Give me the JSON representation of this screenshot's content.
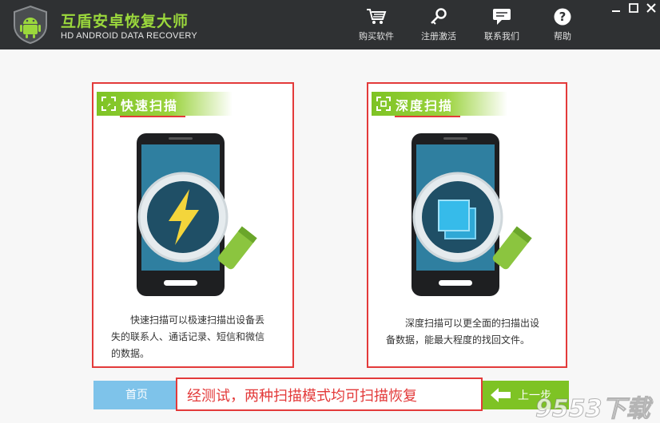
{
  "app": {
    "title_cn": "互盾安卓恢复大师",
    "title_en": "HD ANDROID DATA RECOVERY"
  },
  "nav": [
    {
      "label": "购买软件",
      "icon": "cart-icon"
    },
    {
      "label": "注册激活",
      "icon": "key-icon"
    },
    {
      "label": "联系我们",
      "icon": "chat-icon"
    },
    {
      "label": "帮助",
      "icon": "help-icon"
    }
  ],
  "cards": {
    "quick": {
      "title": "快速扫描",
      "desc_line1": "快速扫描可以极速扫描出设备丢",
      "desc_line2": "失的联系人、通话记录、短信和微信",
      "desc_line3": "的数据。"
    },
    "deep": {
      "title": "深度扫描",
      "desc_line1": "深度扫描可以更全面的扫描出设",
      "desc_line2": "备数据，能最大程度的找回文件。"
    }
  },
  "bottom": {
    "home_label": "首页",
    "caption": "经测试，两种扫描模式均可扫描恢复",
    "prev_label": "上一步"
  },
  "watermark": "9553下载",
  "colors": {
    "titlebar": "#2f3133",
    "accent_green": "#7ec324",
    "highlight_red": "#e33a3a",
    "home_blue": "#7ec3ea"
  }
}
